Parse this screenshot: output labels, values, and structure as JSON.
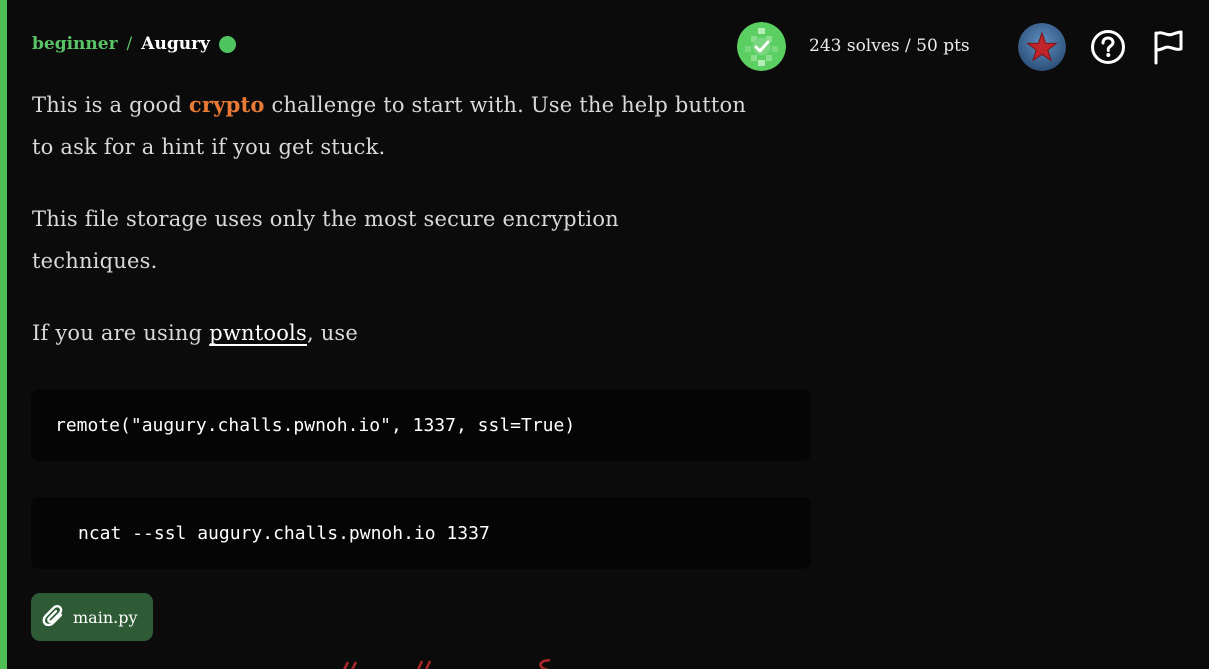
{
  "breadcrumb": {
    "category": "beginner",
    "separator": "/",
    "title": "Augury"
  },
  "stats": {
    "text": "243 solves / 50 pts"
  },
  "description": {
    "p1_before": "This is a good ",
    "p1_keyword": "crypto",
    "p1_after": " challenge to start with. Use the help button to ask for a hint if you get stuck.",
    "p2": "This file storage uses only the most secure encryption techniques.",
    "p3_before": "If you are using ",
    "p3_link": "pwntools",
    "p3_after": ", use"
  },
  "code": {
    "pwntools": "remote(\"augury.challs.pwnoh.io\", 1337, ssl=True)",
    "ncat": "ncat --ssl augury.challs.pwnoh.io 1337"
  },
  "attachment": {
    "filename": "main.py",
    "icon": "paperclip-icon"
  },
  "colors": {
    "accent": "#4fbf55",
    "keyword": "#e97a36",
    "chip_bg": "#2e5a35",
    "background": "#0b0b0b"
  },
  "icons": {
    "solved": "check-badge-icon",
    "rank": "star-badge-icon",
    "help": "help-circle-icon",
    "flag": "flag-icon"
  }
}
